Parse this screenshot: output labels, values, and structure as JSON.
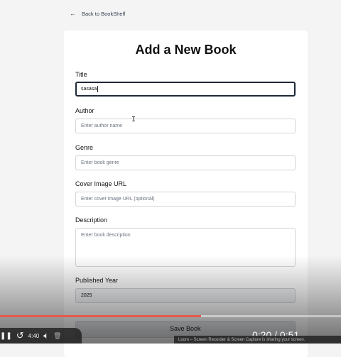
{
  "back_link": {
    "label": "Back to BookShelf"
  },
  "form": {
    "title": "Add a New Book",
    "fields": [
      {
        "label": "Title",
        "value": "sasasa",
        "placeholder": ""
      },
      {
        "label": "Author",
        "value": "",
        "placeholder": "Enter author name"
      },
      {
        "label": "Genre",
        "value": "",
        "placeholder": "Enter book genre"
      },
      {
        "label": "Cover Image URL",
        "value": "",
        "placeholder": "Enter cover image URL (optional)"
      },
      {
        "label": "Description",
        "value": "",
        "placeholder": "Enter book description"
      },
      {
        "label": "Published Year",
        "value": "2025",
        "placeholder": ""
      }
    ],
    "submit_label": "Save Book"
  },
  "player": {
    "current_time": "0:20",
    "duration": "0:51",
    "time_display": "0:20 / 0:51",
    "elapsed_small": "4:40",
    "progress": 0.59,
    "progress_color": "#e8584b"
  },
  "taskbar": {
    "text": "Loom – Screen Recorder & Screen Capture is sharing your screen."
  }
}
